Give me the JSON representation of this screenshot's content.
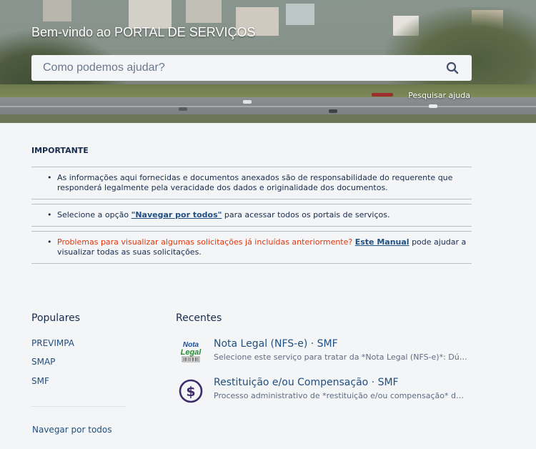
{
  "hero": {
    "title": "Bem-vindo ao PORTAL DE SERVIÇOS",
    "search_placeholder": "Como podemos ajudar?",
    "help_link": "Pesquisar ajuda"
  },
  "notice": {
    "heading": "IMPORTANTE",
    "item1": "As informações aqui fornecidas e documentos anexados são de responsabilidade do requerente que responderá legalmente pela veracidade dos dados e originalidade dos documentos.",
    "item2_pre": "Selecione a opção ",
    "item2_link": "\"Navegar por todos\"",
    "item2_post": " para acessar todos os portais de serviços.",
    "item3_red": "Problemas para visualizar algumas solicitações já incluídas anteriormente?",
    "item3_link": "Este Manual",
    "item3_post": " pode ajudar a visualizar todas as suas solicitações."
  },
  "popular": {
    "title": "Populares",
    "items": [
      "PREVIMPA",
      "SMAP",
      "SMF"
    ],
    "browse_all": "Navegar por todos"
  },
  "recent": {
    "title": "Recentes",
    "items": [
      {
        "title": "Nota Legal (NFS-e) · SMF",
        "desc": "Selecione este serviço para tratar da *Nota Legal (NFS-e)*: Dú…",
        "icon": "nota-legal-logo",
        "logo_text": "Nota Legal"
      },
      {
        "title": "Restituição e/ou Compensação · SMF",
        "desc": "Processo administrativo de *restituição e/ou compensação* d…",
        "icon": "dollar-circle-icon"
      }
    ]
  },
  "colors": {
    "link": "#205081",
    "warning": "#de350b",
    "text": "#172b4d",
    "background": "#f4f5f7"
  }
}
